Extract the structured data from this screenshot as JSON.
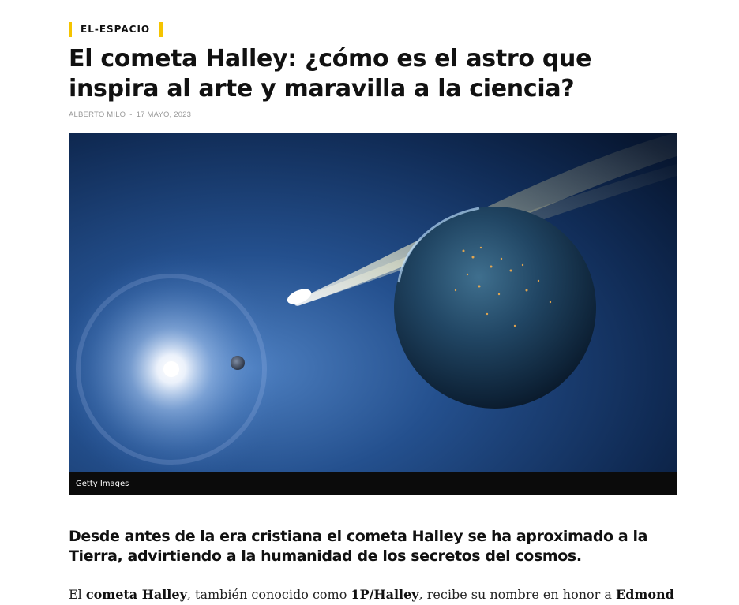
{
  "article": {
    "category": "EL-ESPACIO",
    "headline": "El cometa Halley: ¿cómo es el astro que inspira al arte y maravilla a la ciencia?",
    "author": "ALBERTO MILO",
    "separator": "-",
    "date": "17 MAYO, 2023",
    "image": {
      "alt": "Comet flying past the Earth with the Sun and a small moon in space",
      "credit": "Getty Images"
    },
    "lead": "Desde antes de la era cristiana el cometa Halley se ha aproximado a la Tierra, advirtiendo a la humanidad de los secretos del cosmos.",
    "body": {
      "p1_text1": "El ",
      "p1_bold1": "cometa Halley",
      "p1_text2": ", también conocido como ",
      "p1_bold2": "1P/Halley",
      "p1_text3": ", recibe su nombre en honor a ",
      "p1_bold3": "Edmond"
    }
  },
  "colors": {
    "accent": "#f5c400",
    "text": "#111111",
    "meta": "#999999",
    "caption_bg": "#0b0b0b"
  }
}
